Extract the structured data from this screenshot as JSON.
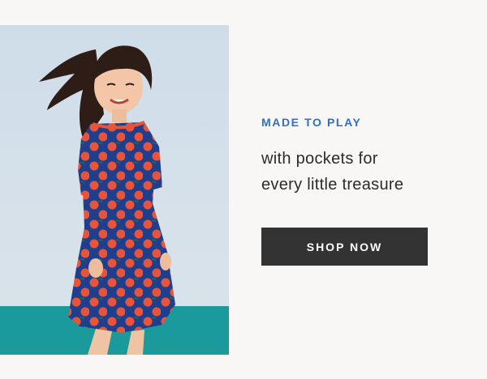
{
  "promo": {
    "eyebrow": "MADE TO PLAY",
    "headline_line1": "with pockets for",
    "headline_line2": "every little treasure",
    "cta_label": "SHOP NOW"
  },
  "colors": {
    "page_background": "#f8f7f5",
    "eyebrow_blue": "#2f6fc6",
    "button_background": "#333333",
    "button_text": "#ffffff",
    "photo_floor_teal": "#1a9a9a",
    "dress_green": "#14514f",
    "dress_blue": "#1f3f8c",
    "dress_apple_red": "#e8533a"
  }
}
